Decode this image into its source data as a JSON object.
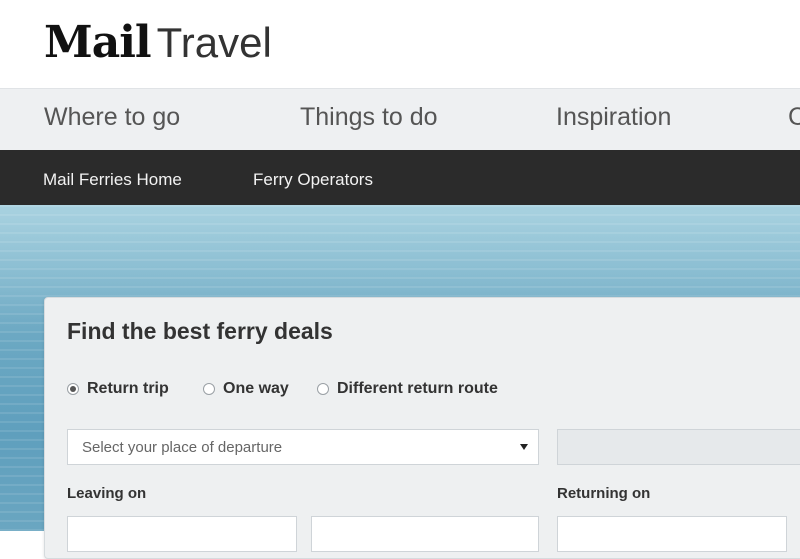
{
  "brand": {
    "mail": "Mail",
    "travel": "Travel"
  },
  "primary_nav": [
    {
      "label": "Where to go"
    },
    {
      "label": "Things to do"
    },
    {
      "label": "Inspiration"
    },
    {
      "label": "C"
    }
  ],
  "secondary_nav": [
    {
      "label": "Mail Ferries Home"
    },
    {
      "label": "Ferry Operators"
    }
  ],
  "search": {
    "title": "Find the best ferry deals",
    "trip_types": [
      {
        "label": "Return trip",
        "selected": true
      },
      {
        "label": "One way",
        "selected": false
      },
      {
        "label": "Different return route",
        "selected": false
      }
    ],
    "departure_placeholder": "Select your place of departure",
    "leaving_label": "Leaving on",
    "returning_label": "Returning on"
  },
  "icons": {
    "dropdown": "chevron-down-icon"
  }
}
